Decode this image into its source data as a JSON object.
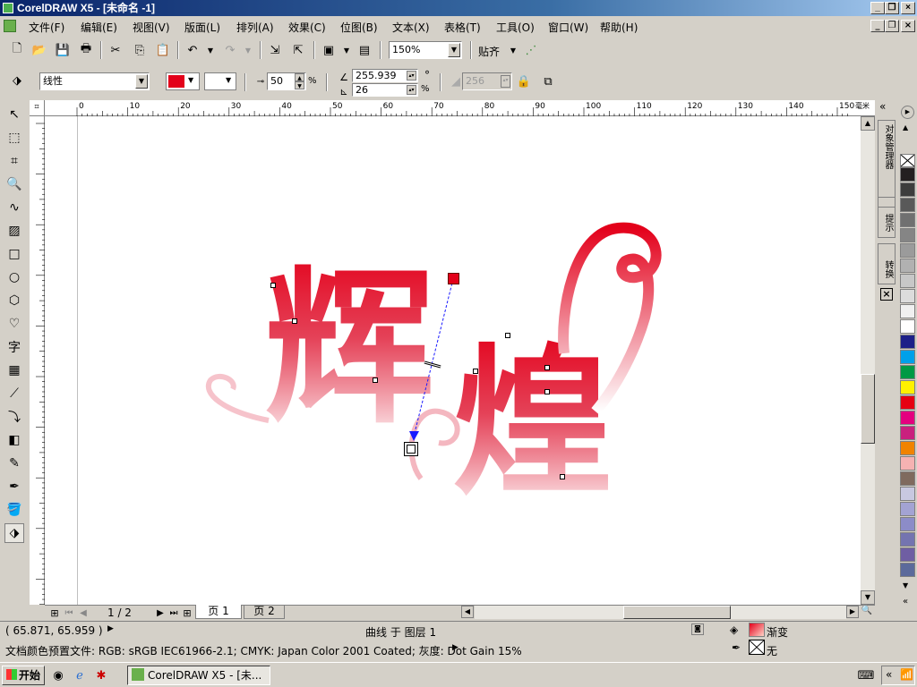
{
  "window": {
    "title": "CorelDRAW X5 - [未命名 -1]"
  },
  "menu": [
    "文件(F)",
    "编辑(E)",
    "视图(V)",
    "版面(L)",
    "排列(A)",
    "效果(C)",
    "位图(B)",
    "文本(X)",
    "表格(T)",
    "工具(O)",
    "窗口(W)",
    "帮助(H)"
  ],
  "toolbar": {
    "zoom": "150%",
    "snap_label": "贴齐"
  },
  "property": {
    "fill_type": "线性",
    "start_color": "#e3001a",
    "end_color": "#ffffff",
    "midpoint": "50",
    "percent": "%",
    "angle": "255.939",
    "degree": "°",
    "edge": "26",
    "edge_unit": "%",
    "steps": "256"
  },
  "ruler": {
    "top_labels": [
      "0",
      "10",
      "20",
      "30",
      "40",
      "50",
      "60",
      "70",
      "80",
      "90",
      "100",
      "110",
      "120",
      "130",
      "140",
      "150"
    ],
    "top_unit": "毫米",
    "left_labels": [
      "130",
      "120",
      "110",
      "100",
      "90",
      "80",
      "70",
      "60",
      "50",
      "40"
    ]
  },
  "artwork": {
    "char1": "辉",
    "char2": "煌",
    "color": "#e0203a"
  },
  "pages": {
    "counter": "1 / 2",
    "tab1": "页 1",
    "tab2": "页 2"
  },
  "dockers": [
    "对象管理器",
    "提示",
    "转换"
  ],
  "palette": [
    "#231f20",
    "#3d3d3d",
    "#595959",
    "#707070",
    "#858585",
    "#9b9b9b",
    "#b1b1b1",
    "#c7c7c7",
    "#dcdcdc",
    "#f0f0f0",
    "#ffffff",
    "#1d2088",
    "#00a0e9",
    "#009944",
    "#fff100",
    "#e60012",
    "#e4007f",
    "#c9207e",
    "#f08300",
    "#f5b2b2",
    "#7f6a5e",
    "#c8c8e0",
    "#a3a3d3",
    "#8c8cc8",
    "#7474b0",
    "#6f5ea3",
    "#5c6a9b"
  ],
  "status": {
    "coords": "( 65.871, 65.959 )",
    "object": "曲线 于 图层 1",
    "profile": "文档颜色预置文件: RGB: sRGB IEC61966-2.1; CMYK: Japan Color 2001 Coated; 灰度: Dot Gain 15%",
    "fill_label": "渐变",
    "outline_label": "无"
  },
  "taskbar": {
    "start": "开始",
    "app": "CorelDRAW X5 - [未..."
  }
}
